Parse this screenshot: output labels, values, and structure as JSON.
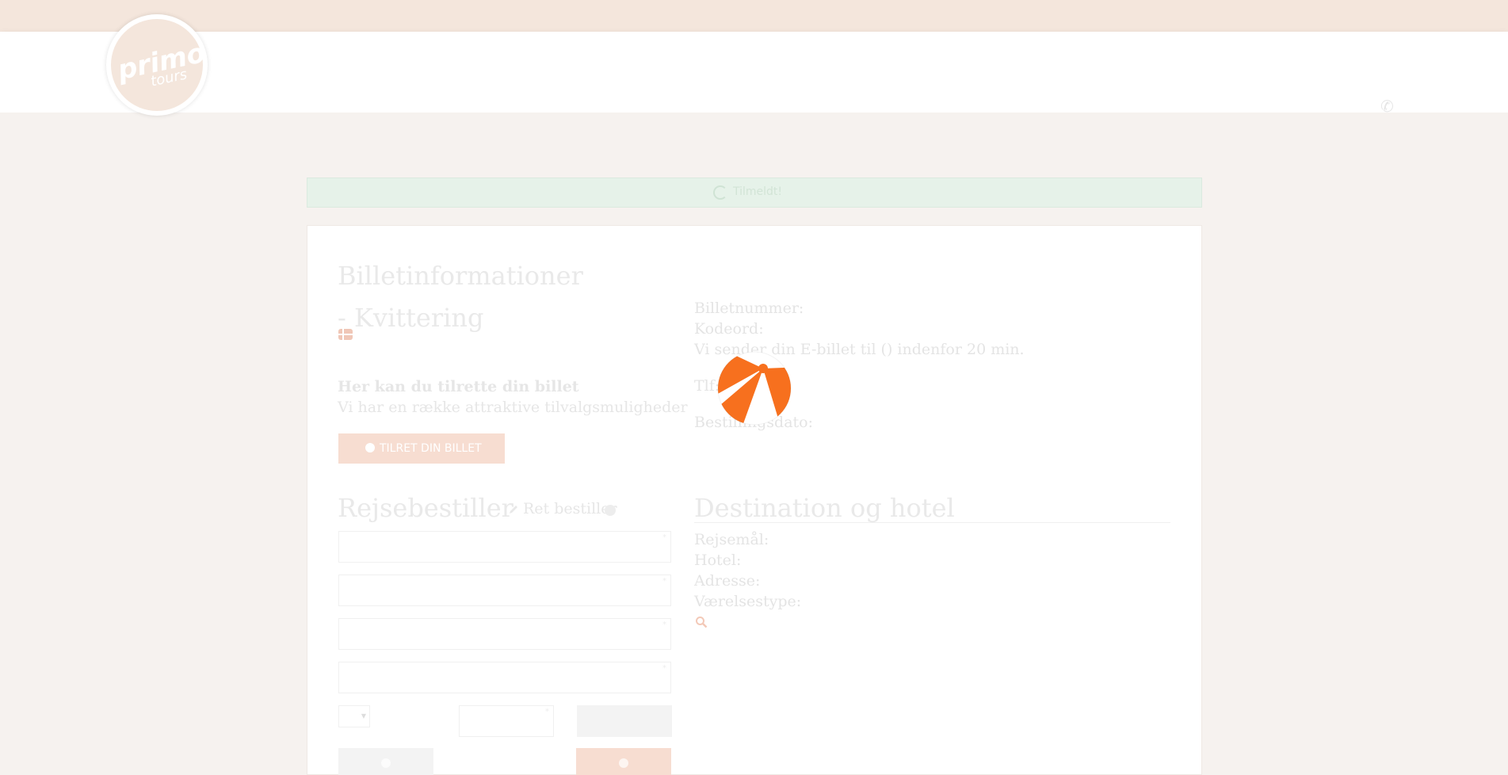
{
  "header": {
    "logo": {
      "brand": "primo",
      "sub": "tours"
    },
    "phone_icon": "phone-icon"
  },
  "alert": {
    "icon": "spinner-icon",
    "text": "Tilmeldt!"
  },
  "ticket": {
    "title": "Billetinformationer - Kvittering",
    "flag_icon": "flag-dk-icon",
    "number_label": "Billetnummer:",
    "code_label": "Kodeord:",
    "email_note": "Vi sender din E-billet til () indenfor 20 min.",
    "phone_label": "Tlf:",
    "date_label": "Bestillingsdato:"
  },
  "upgrade": {
    "title": "Her kan du tilrette din billet",
    "subtitle": "Vi har en række attraktive tilvalgsmuligheder",
    "button_label": "TILRET DIN BILLET",
    "button_icon": "plus-circle-icon"
  },
  "booker": {
    "title": "Rejsebestiller",
    "edit_label": "Ret bestiller",
    "edit_icon": "pencil-icon",
    "info_icon": "info-icon",
    "fields": [
      {
        "value": "",
        "required_mark": "*"
      },
      {
        "value": "",
        "required_mark": "*"
      },
      {
        "value": "",
        "required_mark": "*"
      },
      {
        "value": "",
        "required_mark": "*"
      }
    ],
    "phone_prefix": "",
    "phone_value": "",
    "small_required_mark": "*"
  },
  "destination": {
    "title": "Destination og hotel",
    "destination_label": "Rejsemål:",
    "hotel_label": "Hotel:",
    "address_label": "Adresse:",
    "roomtype_label": "Værelsestype:",
    "search_icon": "search-icon"
  },
  "actions": {
    "save_icon": "dot-icon",
    "cancel_icon": "dot-icon",
    "save_color": "#f3f3f3",
    "cancel_color": "#f7ddd1"
  },
  "loader": {
    "icon": "beach-ball-icon",
    "colors": [
      "#f7701e",
      "#ffffff"
    ]
  },
  "colors": {
    "accent": "#f7701e",
    "alert_bg": "#e6f2e9",
    "top_strip": "#f4e6dc"
  }
}
